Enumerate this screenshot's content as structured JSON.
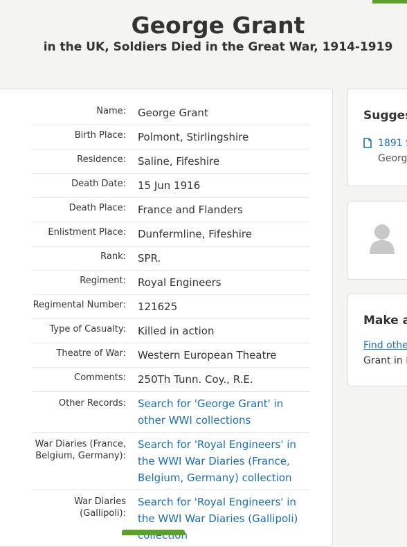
{
  "header": {
    "title": "George Grant",
    "subtitle": "in the UK, Soldiers Died in the Great War, 1914-1919"
  },
  "record": [
    {
      "label": "Name:",
      "value": "George Grant"
    },
    {
      "label": "Birth Place:",
      "value": "Polmont, Stirlingshire"
    },
    {
      "label": "Residence:",
      "value": "Saline, Fifeshire"
    },
    {
      "label": "Death Date:",
      "value": "15 Jun 1916"
    },
    {
      "label": "Death Place:",
      "value": "France and Flanders"
    },
    {
      "label": "Enlistment Place:",
      "value": "Dunfermline, Fifeshire"
    },
    {
      "label": "Rank:",
      "value": "SPR."
    },
    {
      "label": "Regiment:",
      "value": "Royal Engineers"
    },
    {
      "label": "Regimental Number:",
      "value": "121625"
    },
    {
      "label": "Type of Casualty:",
      "value": "Killed in action"
    },
    {
      "label": "Theatre of War:",
      "value": "Western European Theatre"
    },
    {
      "label": "Comments:",
      "value": "250Th Tunn. Coy., R.E."
    },
    {
      "label": "Other Records:",
      "value": "Search for 'George Grant' in other WWI collections"
    },
    {
      "label": "War Diaries (France, Belgium, Germany):",
      "value": "Search for 'Royal Engineers' in the WWI War Diaries (France, Belgium, Germany) collection"
    },
    {
      "label": "War Diaries (Gallipoli):",
      "value": "Search for 'Royal Engineers' in the WWI War Diaries (Gallipoli) collection"
    }
  ],
  "sidebar": {
    "suggested_heading": "Sugges",
    "suggested_link": "1891 S",
    "suggested_sub": "Georg",
    "make_heading": "Make a",
    "find_link": "Find othe",
    "find_sub": "Grant in I"
  },
  "colors": {
    "accent_green": "#5aa22a",
    "link_blue": "#1a70b5"
  }
}
